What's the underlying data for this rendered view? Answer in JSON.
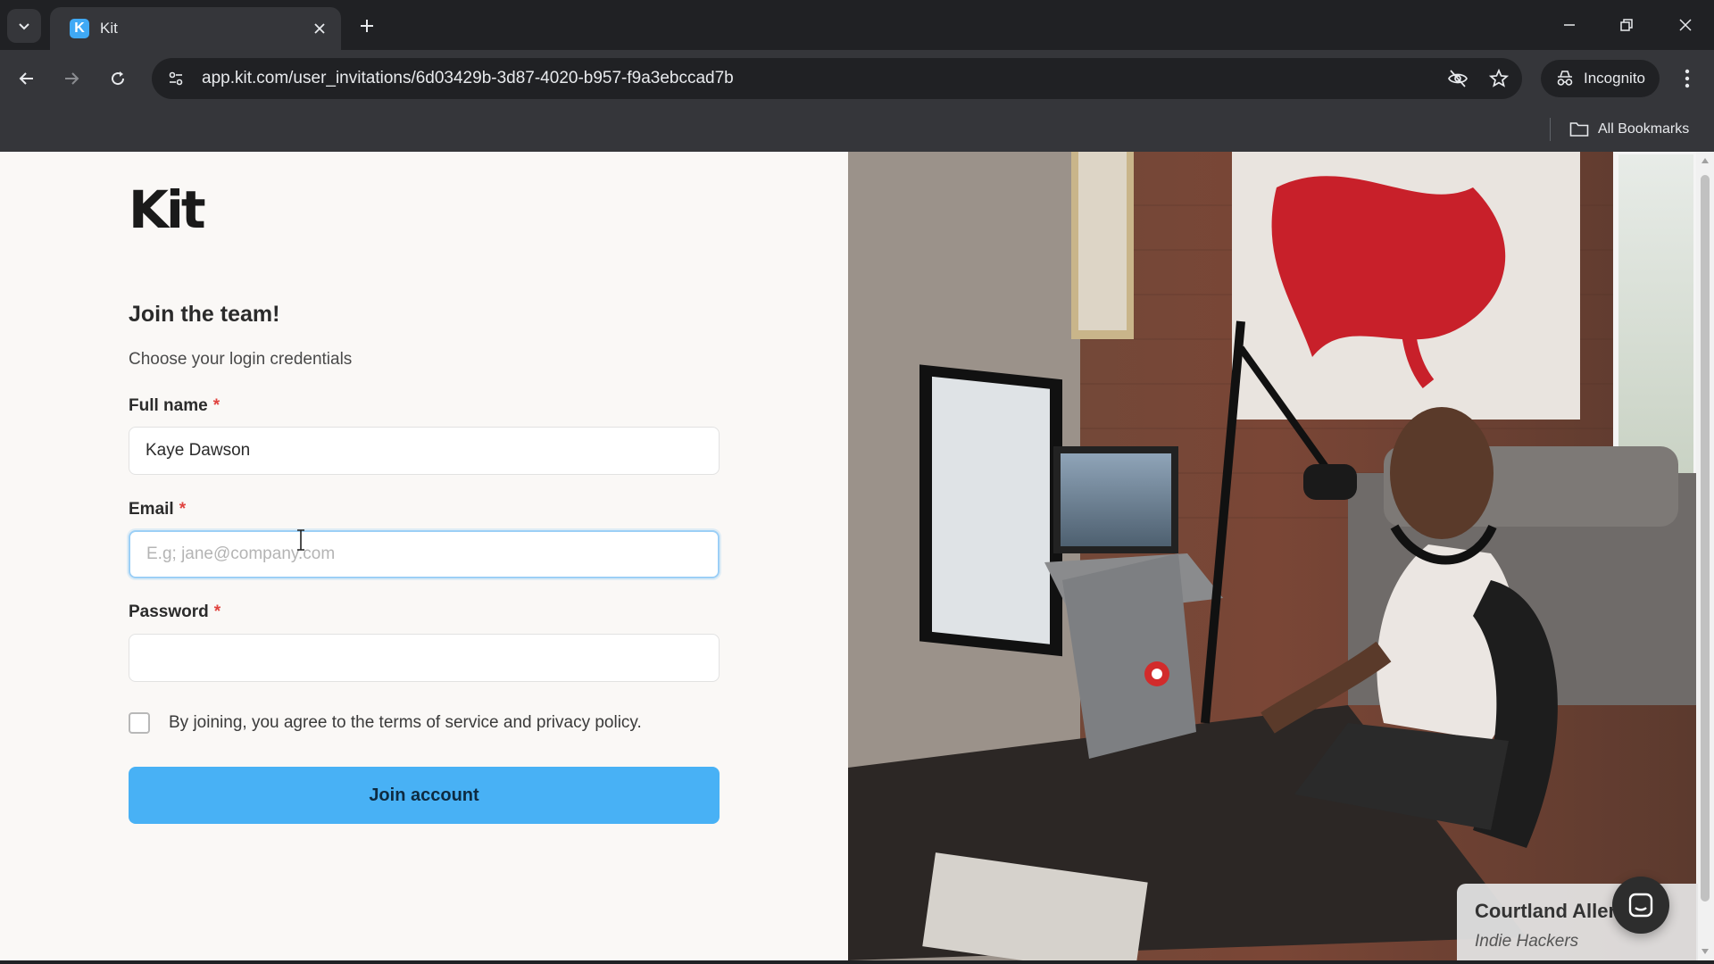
{
  "browser": {
    "tab_title": "Kit",
    "tab_favicon_letter": "K",
    "url": "app.kit.com/user_invitations/6d03429b-3d87-4020-b957-f9a3ebccad7b",
    "incognito_label": "Incognito",
    "all_bookmarks_label": "All Bookmarks"
  },
  "page": {
    "logo": "Kit",
    "heading": "Join the team!",
    "subheading": "Choose your login credentials",
    "required_mark": "*",
    "fields": {
      "full_name": {
        "label": "Full name",
        "value": "Kaye Dawson",
        "placeholder": ""
      },
      "email": {
        "label": "Email",
        "value": "",
        "placeholder": "E.g; jane@company.com"
      },
      "password": {
        "label": "Password",
        "value": "",
        "placeholder": ""
      }
    },
    "terms_text": "By joining, you agree to the terms of service and privacy policy.",
    "terms_checked": false,
    "submit_label": "Join account"
  },
  "testimonial": {
    "name": "Courtland Allen",
    "org": "Indie Hackers"
  },
  "colors": {
    "accent": "#48b1f5",
    "required": "#e0433f",
    "page_bg": "#faf8f6"
  }
}
